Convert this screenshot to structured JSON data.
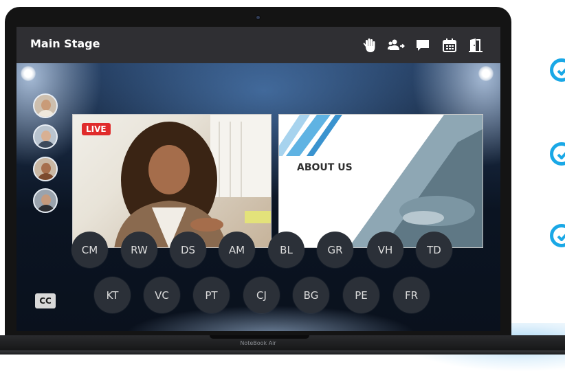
{
  "window": {
    "title": "Main Stage"
  },
  "toolbar": {
    "icons": [
      "raise-hand-icon",
      "invite-attendees-icon",
      "chat-icon",
      "calendar-icon",
      "exit-door-icon"
    ]
  },
  "stage": {
    "live_badge": "LIVE",
    "slide_title": "ABOUT US",
    "speakers": [
      "speaker-avatar-1",
      "speaker-avatar-2",
      "speaker-avatar-3",
      "speaker-avatar-4"
    ],
    "attendees_row1": [
      "CM",
      "RW",
      "DS",
      "AM",
      "BL",
      "GR",
      "VH",
      "TD"
    ],
    "attendees_row2": [
      "KT",
      "VC",
      "PT",
      "CJ",
      "BG",
      "PE",
      "FR"
    ],
    "cc_button": "CC"
  },
  "device": {
    "model_label": "NoteBook Air"
  },
  "colors": {
    "accent": "#1aa8e6",
    "live": "#e02b2b",
    "topbar": "#2f2f33"
  }
}
